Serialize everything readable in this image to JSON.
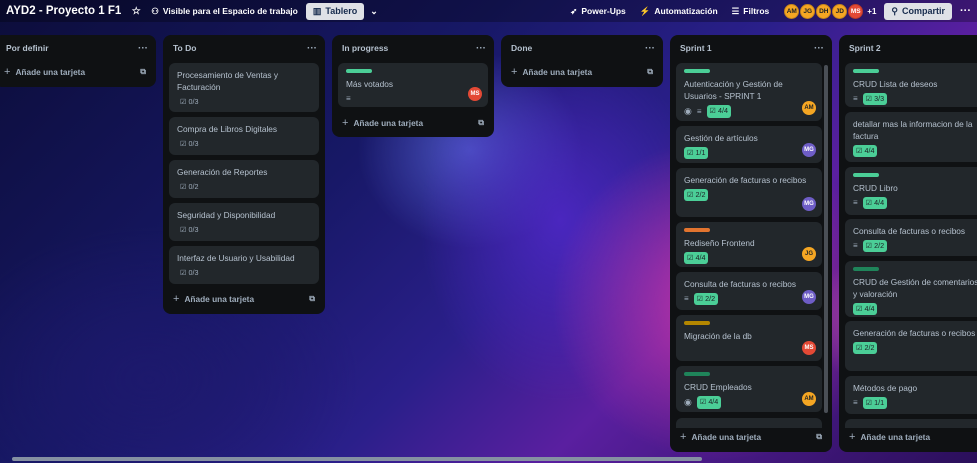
{
  "header": {
    "board_title": "AYD2 - Proyecto 1 F1",
    "visibility": "Visible para el Espacio de trabajo",
    "view": "Tablero",
    "powerups": "Power-Ups",
    "automation": "Automatización",
    "filters": "Filtros",
    "extra_members": "+1",
    "share": "Compartir",
    "members": [
      {
        "initials": "AM",
        "color": "#f5a623"
      },
      {
        "initials": "JG",
        "color": "#f5a623"
      },
      {
        "initials": "DH",
        "color": "#f5a623"
      },
      {
        "initials": "JD",
        "color": "#f5a623"
      },
      {
        "initials": "MS",
        "color": "#e34935"
      }
    ]
  },
  "add_card": "Añade una tarjeta",
  "lists": [
    {
      "title": "Por definir",
      "cards": []
    },
    {
      "title": "To Do",
      "cards": [
        {
          "title": "Procesamiento de Ventas y Facturación",
          "checklist": "0/3"
        },
        {
          "title": "Compra de Libros Digitales",
          "checklist": "0/3"
        },
        {
          "title": "Generación de Reportes",
          "checklist": "0/2"
        },
        {
          "title": "Seguridad y Disponibilidad",
          "checklist": "0/3"
        },
        {
          "title": "Interfaz de Usuario y Usabilidad",
          "checklist": "0/3"
        }
      ]
    },
    {
      "title": "In progress",
      "cards": [
        {
          "title": "Más votados",
          "label": "#4bce97",
          "member": "MS"
        }
      ]
    },
    {
      "title": "Done",
      "cards": []
    },
    {
      "title": "Sprint 1",
      "cards": [
        {
          "title": "Autenticación y Gestión de Usuarios - SPRINT 1",
          "label": "#4bce97",
          "checklist": "4/4",
          "member": "AM"
        },
        {
          "title": "Gestión de artículos",
          "checklist": "1/1",
          "member": "MG"
        },
        {
          "title": "Generación de facturas o recibos",
          "checklist": "2/2",
          "member": "MG"
        },
        {
          "title": "Rediseño Frontend",
          "label": "#f87168",
          "checklist": "4/4",
          "member": "JG"
        },
        {
          "title": "Consulta de facturas o recibos",
          "checklist": "2/2",
          "member": "MG"
        },
        {
          "title": "Migración de la db",
          "label": "#e2b203",
          "member": "MS"
        },
        {
          "title": "CRUD Empleados",
          "label": "#4bce97",
          "checklist": "4/4",
          "member": "AM"
        }
      ]
    },
    {
      "title": "Sprint 2",
      "cards": [
        {
          "title": "CRUD Lista de deseos",
          "label": "#4bce97",
          "checklist": "3/3"
        },
        {
          "title": "detallar mas la informacion de la factura",
          "checklist": "4/4"
        },
        {
          "title": "CRUD Libro",
          "label": "#4bce97",
          "checklist": "4/4"
        },
        {
          "title": "Consulta de facturas o recibos",
          "checklist": "2/2"
        },
        {
          "title": "CRUD de Gestión de comentarios y valoración",
          "label": "#4bce97",
          "checklist": "4/4"
        },
        {
          "title": "Generación de facturas o recibos",
          "checklist": "2/2"
        },
        {
          "title": "Métodos de pago",
          "checklist": "1/1"
        }
      ]
    }
  ]
}
